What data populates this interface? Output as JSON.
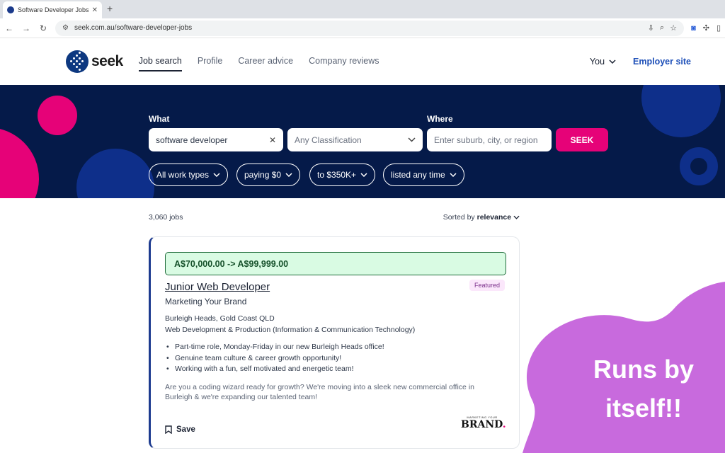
{
  "browser": {
    "tab_title": "Software Developer Jobs in A",
    "tab_close": "✕",
    "new_tab": "+",
    "url": "seek.com.au/software-developer-jobs"
  },
  "site": {
    "logo_text": "seek",
    "nav": [
      {
        "label": "Job search",
        "active": true
      },
      {
        "label": "Profile"
      },
      {
        "label": "Career advice"
      },
      {
        "label": "Company reviews"
      }
    ],
    "you_label": "You",
    "employer_label": "Employer site"
  },
  "search": {
    "what_label": "What",
    "what_value": "software developer",
    "classification_placeholder": "Any Classification",
    "where_label": "Where",
    "where_placeholder": "Enter suburb, city, or region",
    "seek_button": "SEEK",
    "filters": [
      "All work types",
      "paying $0",
      "to $350K+",
      "listed any time"
    ]
  },
  "results": {
    "count": "3,060 jobs",
    "sort_prefix": "Sorted by",
    "sort_value": "relevance"
  },
  "job": {
    "salary": "A$70,000.00 -> A$99,999.00",
    "badge": "Featured",
    "title": "Junior Web Developer",
    "company": "Marketing Your Brand",
    "location": "Burleigh Heads, Gold Coast QLD",
    "category": "Web Development & Production  (Information & Communication Technology)",
    "bullets": [
      "Part-time role, Monday-Friday in our new Burleigh Heads office!",
      "Genuine team culture & career growth opportunity!",
      "Working with a fun, self motivated and energetic team!"
    ],
    "description": "Are you a coding wizard ready for growth? We're moving into a sleek new commercial office in Burleigh & we're expanding our talented team!",
    "save_label": "Save",
    "brand_logo_small": "MARKETING YOUR",
    "brand_logo_big": "BRAND",
    "brand_logo_dot": "."
  },
  "overlay": {
    "line1": "Runs by",
    "line2": "itself!!",
    "color": "#c86add"
  },
  "colors": {
    "hero_bg": "#051a49",
    "seek_pink": "#e60278",
    "brand_blue": "#0d3880"
  }
}
